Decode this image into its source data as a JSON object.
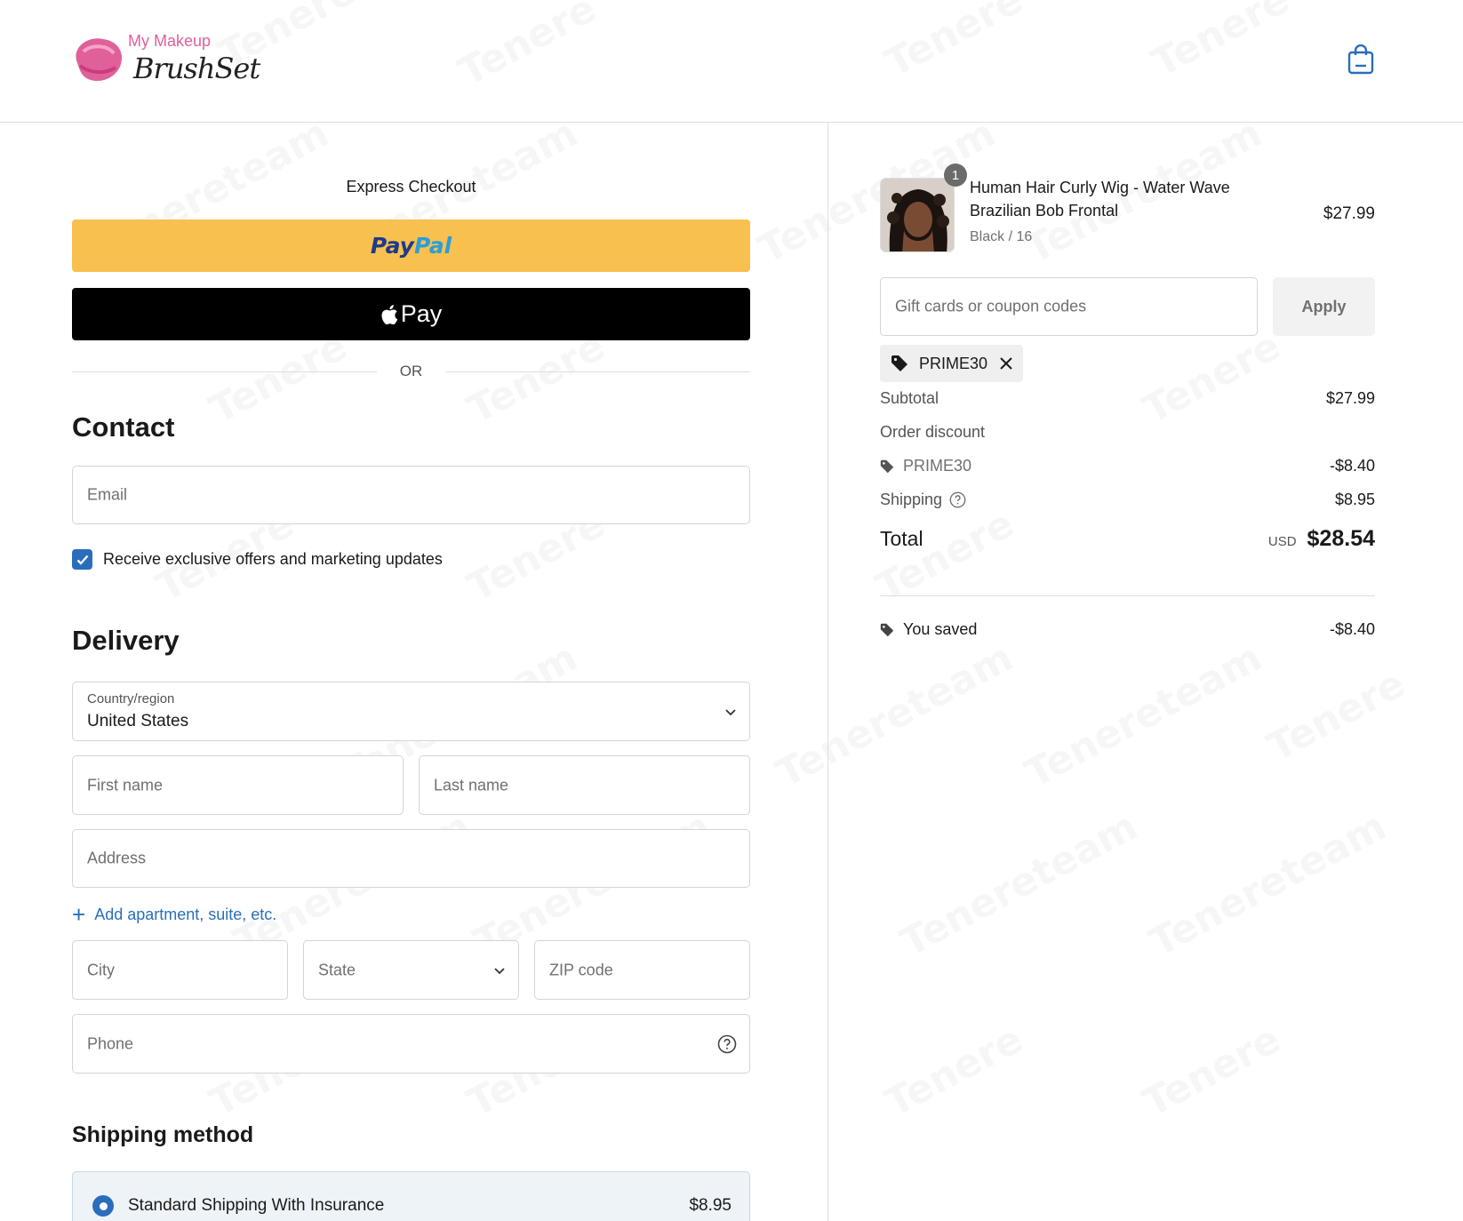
{
  "brand": {
    "line1": "My Makeup",
    "line2": "BrushSet"
  },
  "express": {
    "title": "Express Checkout",
    "paypal_a": "Pay",
    "paypal_b": "Pal",
    "applepay": "Pay",
    "or": "OR"
  },
  "contact": {
    "heading": "Contact",
    "email_placeholder": "Email",
    "marketing_label": "Receive exclusive offers and marketing updates",
    "marketing_checked": true
  },
  "delivery": {
    "heading": "Delivery",
    "country_label": "Country/region",
    "country_value": "United States",
    "first_name": "First name",
    "last_name": "Last name",
    "address": "Address",
    "add_apartment": "Add apartment, suite, etc.",
    "city": "City",
    "state": "State",
    "zip": "ZIP code",
    "phone": "Phone"
  },
  "shipping": {
    "heading": "Shipping method",
    "option_name": "Standard Shipping With Insurance",
    "option_price": "$8.95"
  },
  "cart": {
    "quantity": "1",
    "product_title": "Human Hair Curly Wig - Water Wave Brazilian Bob Frontal",
    "product_variant": "Black / 16",
    "product_price": "$27.99",
    "coupon_placeholder": "Gift cards or coupon codes",
    "apply_label": "Apply",
    "applied_code": "PRIME30"
  },
  "summary": {
    "subtotal_label": "Subtotal",
    "subtotal_value": "$27.99",
    "discount_label": "Order discount",
    "discount_code": "PRIME30",
    "discount_value": "-$8.40",
    "shipping_label": "Shipping",
    "shipping_value": "$8.95",
    "total_label": "Total",
    "total_currency": "USD",
    "total_value": "$28.54",
    "saved_label": "You saved",
    "saved_value": "-$8.40"
  },
  "colors": {
    "accent": "#2a6ebb",
    "paypal": "#f7c04f",
    "brand_pink": "#e0609a"
  }
}
